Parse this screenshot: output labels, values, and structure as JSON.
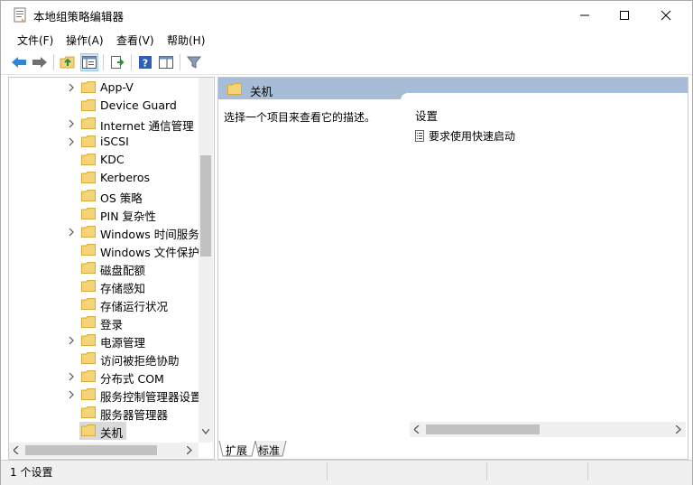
{
  "window": {
    "title": "本地组策略编辑器",
    "controls": [
      "minimize",
      "maximize",
      "close"
    ]
  },
  "menu": [
    "文件(F)",
    "操作(A)",
    "查看(V)",
    "帮助(H)"
  ],
  "toolbar": [
    "back-icon",
    "forward-icon",
    "up-folder-icon",
    "show-tree-icon",
    "export-list-icon",
    "help-icon",
    "properties-icon",
    "filter-icon"
  ],
  "tree": {
    "items": [
      {
        "label": "App-V",
        "expandable": true
      },
      {
        "label": "Device Guard",
        "expandable": false
      },
      {
        "label": "Internet 通信管理",
        "expandable": true
      },
      {
        "label": "iSCSI",
        "expandable": true
      },
      {
        "label": "KDC",
        "expandable": false
      },
      {
        "label": "Kerberos",
        "expandable": false
      },
      {
        "label": "OS 策略",
        "expandable": false
      },
      {
        "label": "PIN 复杂性",
        "expandable": false
      },
      {
        "label": "Windows 时间服务",
        "expandable": true
      },
      {
        "label": "Windows 文件保护",
        "expandable": false
      },
      {
        "label": "磁盘配额",
        "expandable": false
      },
      {
        "label": "存储感知",
        "expandable": false
      },
      {
        "label": "存储运行状况",
        "expandable": false
      },
      {
        "label": "登录",
        "expandable": false
      },
      {
        "label": "电源管理",
        "expandable": true
      },
      {
        "label": "访问被拒绝协助",
        "expandable": false
      },
      {
        "label": "分布式 COM",
        "expandable": true
      },
      {
        "label": "服务控制管理器设置",
        "expandable": true
      },
      {
        "label": "服务器管理器",
        "expandable": false
      },
      {
        "label": "关机",
        "expandable": false,
        "selected": true
      }
    ]
  },
  "details": {
    "header": "关机",
    "description": "选择一个项目来查看它的描述。",
    "column_header": "设置",
    "settings": [
      "要求使用快速启动"
    ]
  },
  "tabs": [
    "扩展",
    "标准"
  ],
  "status": {
    "text": "1 个设置"
  },
  "colors": {
    "header": "#a7bcd6",
    "folder": "#f4d478",
    "folder_edge": "#d9a93a",
    "selection": "#d9d9d9"
  }
}
